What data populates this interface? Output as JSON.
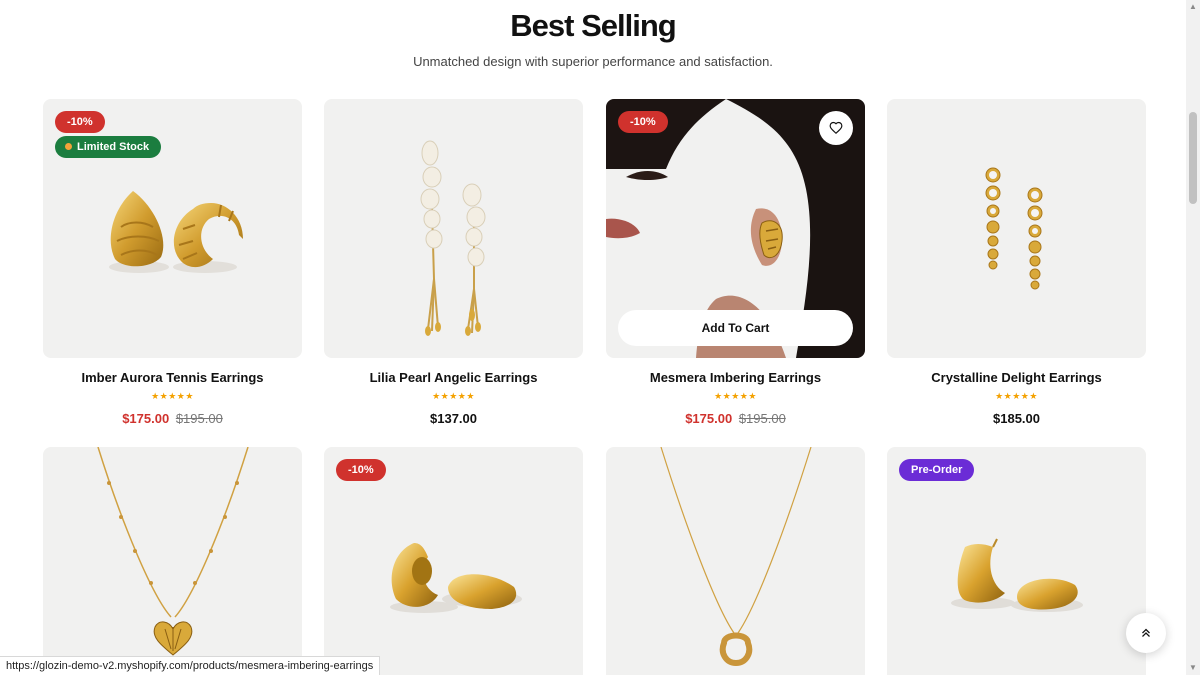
{
  "section": {
    "title": "Best Selling",
    "subtitle": "Unmatched design with superior performance and satisfaction."
  },
  "products": [
    {
      "name": "Imber Aurora Tennis Earrings",
      "sale_price": "$175.00",
      "compare_price": "$195.00",
      "sale_badge": "-10%",
      "stock_badge": "Limited Stock",
      "rating": 5
    },
    {
      "name": "Lilia Pearl Angelic Earrings",
      "price": "$137.00",
      "rating": 5
    },
    {
      "name": "Mesmera Imbering Earrings",
      "sale_price": "$175.00",
      "compare_price": "$195.00",
      "sale_badge": "-10%",
      "add_to_cart": "Add To Cart",
      "rating": 5
    },
    {
      "name": "Crystalline Delight Earrings",
      "price": "$185.00",
      "rating": 5
    },
    {},
    {
      "sale_badge": "-10%"
    },
    {},
    {
      "preorder_badge": "Pre-Order"
    }
  ],
  "colors": {
    "sale": "#d0322d",
    "stock_badge": "#1b7d3f",
    "preorder_badge": "#6b2cd6",
    "stars": "#f4a100",
    "gold": "#d9a93a"
  },
  "stars_text": "★★★★★",
  "status_bar": {
    "url": "https://glozin-demo-v2.myshopify.com/products/mesmera-imbering-earrings"
  },
  "icons": [
    "heart-icon",
    "chevrons-up-icon",
    "dot-icon",
    "arrow-up-icon",
    "arrow-down-icon"
  ]
}
